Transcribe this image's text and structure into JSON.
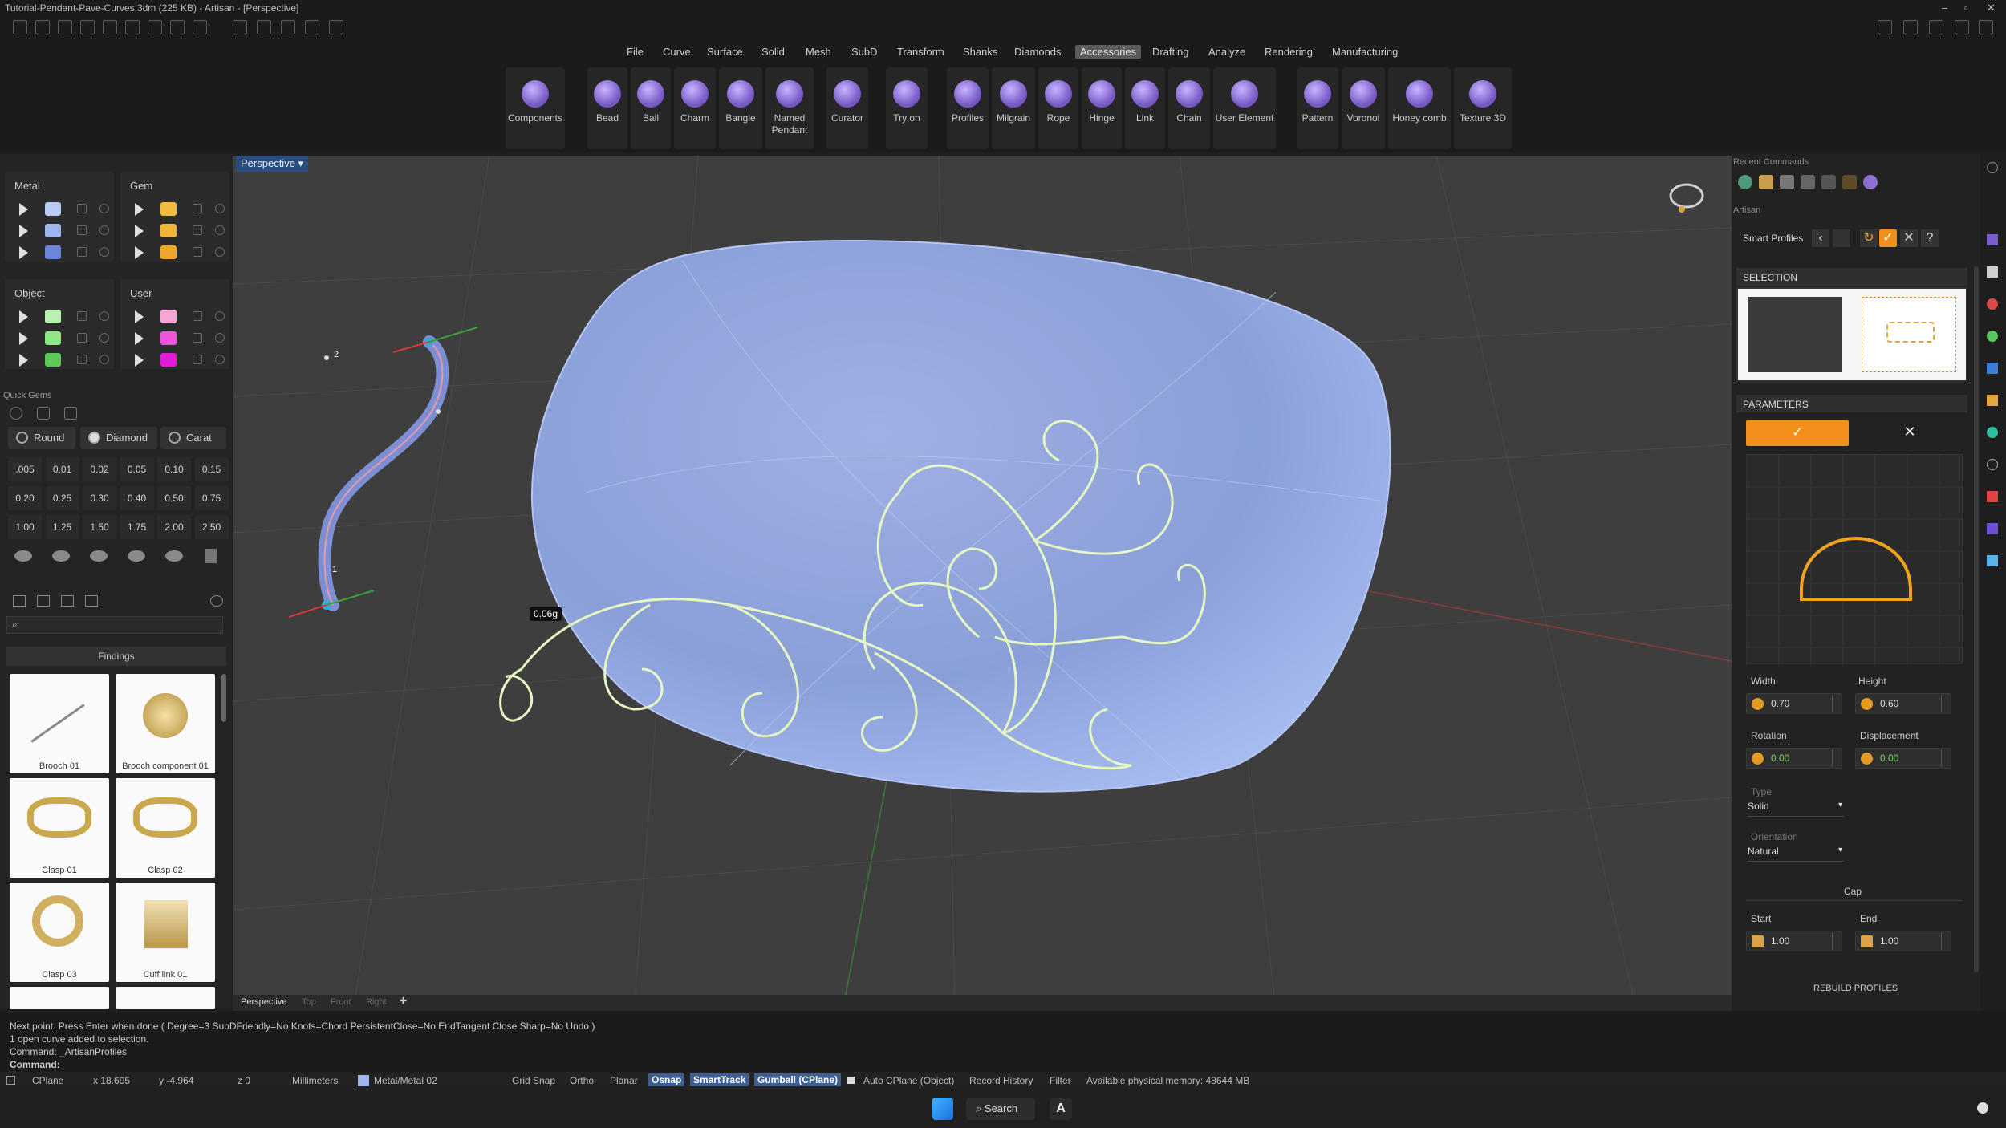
{
  "window": {
    "title": "Tutorial-Pendant-Pave-Curves.3dm (225 KB) - Artisan - [Perspective]"
  },
  "menu": [
    "File",
    "Curve",
    "Surface",
    "Solid",
    "Mesh",
    "SubD",
    "Transform",
    "Shanks",
    "Diamonds",
    "Accessories",
    "Drafting",
    "Analyze",
    "Rendering",
    "Manufacturing"
  ],
  "menu_active": "Accessories",
  "ribbon": [
    "Components",
    "Bead",
    "Bail",
    "Charm",
    "Bangle",
    "Named Pendant",
    "Curator",
    "Try on",
    "Profiles",
    "Milgrain",
    "Rope",
    "Hinge",
    "Link",
    "Chain",
    "User Element",
    "Pattern",
    "Voronoi",
    "Honey comb",
    "Texture 3D"
  ],
  "layers": {
    "metal": "Metal",
    "gem": "Gem",
    "object": "Object",
    "user": "User",
    "metal_colors": [
      "#b9ccf5",
      "#9fb6ee",
      "#6a87dd"
    ],
    "gem_colors": [
      "#f2bc3c",
      "#f0b638",
      "#f0a62c"
    ],
    "object_colors": [
      "#b9f2b0",
      "#8ee688",
      "#5cc85a"
    ],
    "user_colors": [
      "#f7a6d4",
      "#ee55dc",
      "#e21bd6"
    ]
  },
  "quick_gems": {
    "title": "Quick Gems",
    "shape": "Round",
    "cut": "Diamond",
    "unit": "Carat",
    "sizes": [
      ".005",
      "0.01",
      "0.02",
      "0.05",
      "0.10",
      "0.15",
      "0.20",
      "0.25",
      "0.30",
      "0.40",
      "0.50",
      "0.75",
      "1.00",
      "1.25",
      "1.50",
      "1.75",
      "2.00",
      "2.50"
    ]
  },
  "library": {
    "category": "Findings",
    "items": [
      "Brooch 01",
      "Brooch component 01",
      "Clasp 01",
      "Clasp 02",
      "Clasp 03",
      "Cuff link 01"
    ]
  },
  "viewport": {
    "name": "Perspective",
    "weight_label": "0.06g",
    "point_labels": [
      "1",
      "2"
    ],
    "tabs": [
      "Perspective",
      "Top",
      "Front",
      "Right"
    ]
  },
  "right": {
    "recent_title": "Recent Commands",
    "artisan_label": "Artisan",
    "tool_title": "Smart Profiles",
    "selection_title": "SELECTION",
    "parameters_title": "PARAMETERS",
    "width_label": "Width",
    "width_value": "0.70",
    "height_label": "Height",
    "height_value": "0.60",
    "rotation_label": "Rotation",
    "rotation_value": "0.00",
    "displacement_label": "Displacement",
    "displacement_value": "0.00",
    "type_label": "Type",
    "type_value": "Solid",
    "orientation_label": "Orientation",
    "orientation_value": "Natural",
    "cap_label": "Cap",
    "start_label": "Start",
    "start_value": "1.00",
    "end_label": "End",
    "end_value": "1.00",
    "rebuild_label": "REBUILD PROFILES"
  },
  "command": {
    "line1": "Next point. Press Enter when done ( Degree=3  SubDFriendly=No  Knots=Chord  PersistentClose=No  EndTangent  Close  Sharp=No  Undo )",
    "line2": "1 open curve added to selection.",
    "line3": "Command: _ArtisanProfiles",
    "prompt": "Command:"
  },
  "status": {
    "cplane": "CPlane",
    "x": "x 18.695",
    "y": "y -4.964",
    "z": "z 0",
    "units": "Millimeters",
    "layer": "Metal/Metal 02",
    "grid_snap": "Grid Snap",
    "ortho": "Ortho",
    "planar": "Planar",
    "osnap": "Osnap",
    "smarttrack": "SmartTrack",
    "gumball": "Gumball (CPlane)",
    "auto_cplane": "Auto CPlane (Object)",
    "record_history": "Record History",
    "filter": "Filter",
    "memory": "Available physical memory: 48644 MB"
  },
  "taskbar": {
    "search": "Search"
  }
}
